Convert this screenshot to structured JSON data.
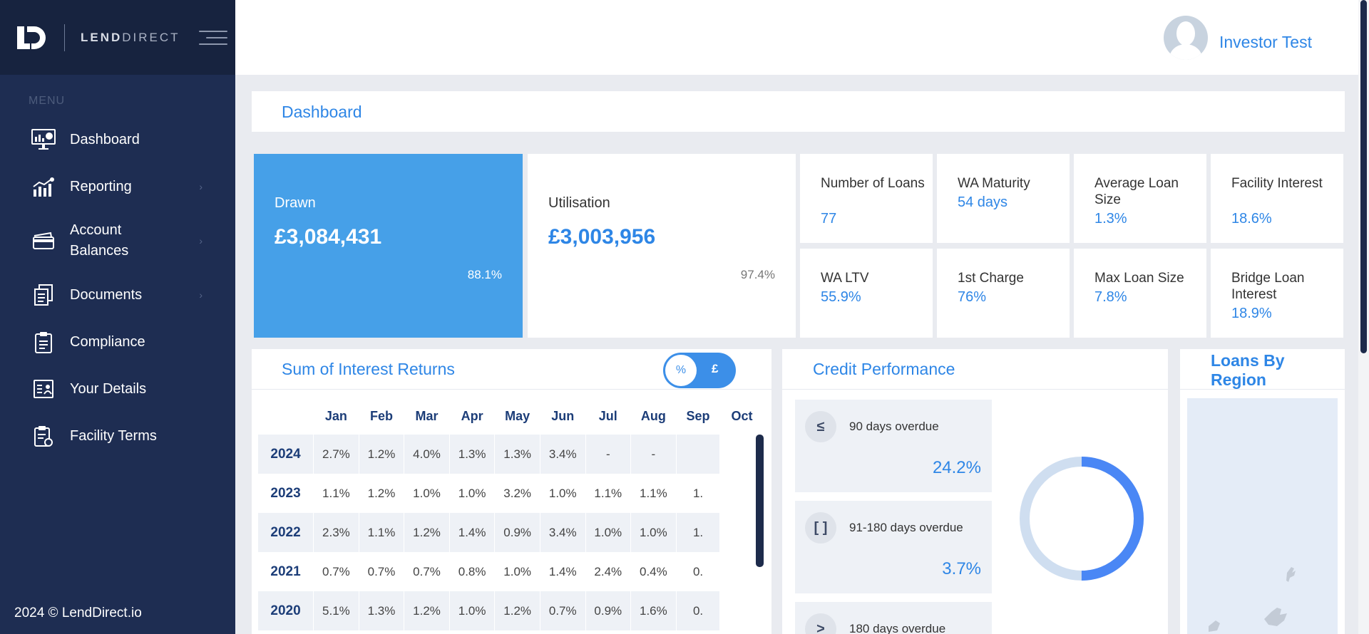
{
  "brand": {
    "name_bold": "LEND",
    "name_thin": "DIRECT"
  },
  "sidebar": {
    "menu_label": "MENU",
    "items": [
      {
        "label": "Dashboard",
        "icon": "dashboard-icon",
        "has_chevron": false
      },
      {
        "label": "Reporting",
        "icon": "reporting-icon",
        "has_chevron": true
      },
      {
        "label": "Account Balances",
        "icon": "wallet-icon",
        "has_chevron": true
      },
      {
        "label": "Documents",
        "icon": "documents-icon",
        "has_chevron": true
      },
      {
        "label": "Compliance",
        "icon": "clipboard-icon",
        "has_chevron": false
      },
      {
        "label": "Your Details",
        "icon": "id-card-icon",
        "has_chevron": false
      },
      {
        "label": "Facility Terms",
        "icon": "contract-icon",
        "has_chevron": false
      }
    ],
    "footer": "2024 © LendDirect.io"
  },
  "header": {
    "user_name": "Investor Test"
  },
  "page": {
    "title": "Dashboard"
  },
  "drawn": {
    "label": "Drawn",
    "value": "£3,084,431",
    "pct": "88.1%"
  },
  "utilisation": {
    "label": "Utilisation",
    "value": "£3,003,956",
    "pct": "97.4%"
  },
  "stats": [
    {
      "label": "Number of Loans",
      "value": "77"
    },
    {
      "label": "WA Maturity",
      "value": "54 days"
    },
    {
      "label": "Average Loan Size",
      "value": "1.3%"
    },
    {
      "label": "Facility Interest",
      "value": "18.6%"
    },
    {
      "label": "WA LTV",
      "value": "55.9%"
    },
    {
      "label": "1st Charge",
      "value": "76%"
    },
    {
      "label": "Max Loan Size",
      "value": "7.8%"
    },
    {
      "label": "Bridge Loan Interest",
      "value": "18.9%"
    }
  ],
  "interest": {
    "title": "Sum of Interest Returns",
    "toggle": {
      "selected": "%",
      "other": "£"
    },
    "months": [
      "Jan",
      "Feb",
      "Mar",
      "Apr",
      "May",
      "Jun",
      "Jul",
      "Aug",
      "Sep",
      "Oct"
    ],
    "rows": [
      {
        "year": "2024",
        "values": [
          "2.7%",
          "1.2%",
          "4.0%",
          "1.3%",
          "1.3%",
          "3.4%",
          "-",
          "-",
          ""
        ]
      },
      {
        "year": "2023",
        "values": [
          "1.1%",
          "1.2%",
          "1.0%",
          "1.0%",
          "3.2%",
          "1.0%",
          "1.1%",
          "1.1%",
          "1."
        ]
      },
      {
        "year": "2022",
        "values": [
          "2.3%",
          "1.1%",
          "1.2%",
          "1.4%",
          "0.9%",
          "3.4%",
          "1.0%",
          "1.0%",
          "1."
        ]
      },
      {
        "year": "2021",
        "values": [
          "0.7%",
          "0.7%",
          "0.7%",
          "0.8%",
          "1.0%",
          "1.4%",
          "2.4%",
          "0.4%",
          "0."
        ]
      },
      {
        "year": "2020",
        "values": [
          "5.1%",
          "1.3%",
          "1.2%",
          "1.0%",
          "1.2%",
          "0.7%",
          "0.9%",
          "1.6%",
          "0."
        ]
      }
    ]
  },
  "credit": {
    "title": "Credit Performance",
    "buckets": [
      {
        "icon_text": "≤",
        "label": "90 days overdue",
        "value": "24.2%"
      },
      {
        "icon_text": "[ ]",
        "label": "91-180 days overdue",
        "value": "3.7%"
      },
      {
        "icon_text": ">",
        "label": "180 days overdue",
        "value": ""
      }
    ],
    "donut_fraction": 0.5,
    "colors": {
      "arc": "#4a87f5",
      "track": "#cfdef0"
    }
  },
  "region": {
    "title": "Loans By Region"
  }
}
